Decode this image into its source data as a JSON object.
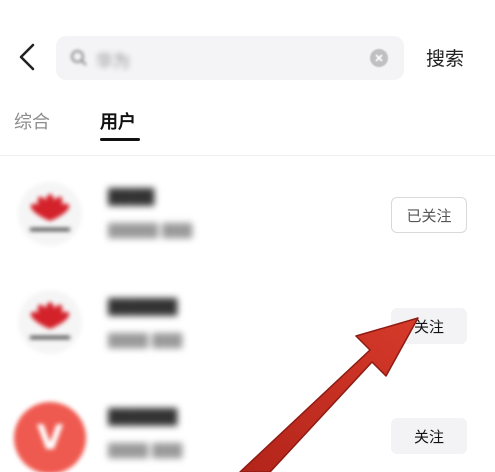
{
  "header": {
    "search_placeholder": "华为",
    "search_button_label": "搜索"
  },
  "tabs": [
    {
      "label": "综合",
      "active": false
    },
    {
      "label": "用户",
      "active": true
    }
  ],
  "users": [
    {
      "avatar": "huawei-logo",
      "follow_label": "已关注",
      "following": true
    },
    {
      "avatar": "huawei-logo",
      "follow_label": "关注",
      "following": false
    },
    {
      "avatar": "vmall-logo",
      "follow_label": "关注",
      "following": false
    }
  ],
  "colors": {
    "accent_arrow": "#c42a1d",
    "huawei_red": "#d4222b",
    "vmall_red": "#ef5a50"
  }
}
